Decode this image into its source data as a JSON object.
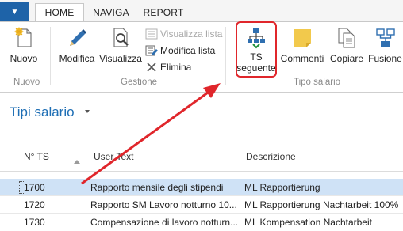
{
  "ribbon_tabs": [
    "HOME",
    "NAVIGA",
    "REPORT"
  ],
  "app_menu_icon": "chevron-down-icon",
  "groups": {
    "nuovo": {
      "label": "Nuovo",
      "buttons": {
        "nuovo": "Nuovo"
      }
    },
    "gestione": {
      "label": "Gestione",
      "buttons": {
        "modifica": "Modifica",
        "visualizza": "Visualizza",
        "visualizza_lista": "Visualizza lista",
        "modifica_lista": "Modifica lista",
        "elimina": "Elimina"
      }
    },
    "tipo_salario": {
      "label": "Tipo salario",
      "buttons": {
        "ts_seguente_line1": "TS",
        "ts_seguente_line2": "seguente",
        "commenti": "Commenti",
        "copiare": "Copiare",
        "fusione": "Fusione"
      }
    }
  },
  "page": {
    "title": "Tipi salario"
  },
  "table": {
    "columns": [
      "N° TS",
      "User Text",
      "Descrizione"
    ],
    "rows": [
      {
        "n": "1700",
        "user_text": "Rapporto mensile degli stipendi",
        "descrizione": "ML Rapportierung"
      },
      {
        "n": "1720",
        "user_text": "Rapporto SM Lavoro notturno 10...",
        "descrizione": "ML Rapportierung Nachtarbeit 100%"
      },
      {
        "n": "1730",
        "user_text": "Compensazione di lavoro notturn...",
        "descrizione": "ML Kompensation Nachtarbeit"
      }
    ]
  },
  "colors": {
    "accent": "#1f6fb5",
    "app_button": "#1e63a8",
    "annotation_red": "#e0262b",
    "selected_row": "#cfe2f6"
  }
}
